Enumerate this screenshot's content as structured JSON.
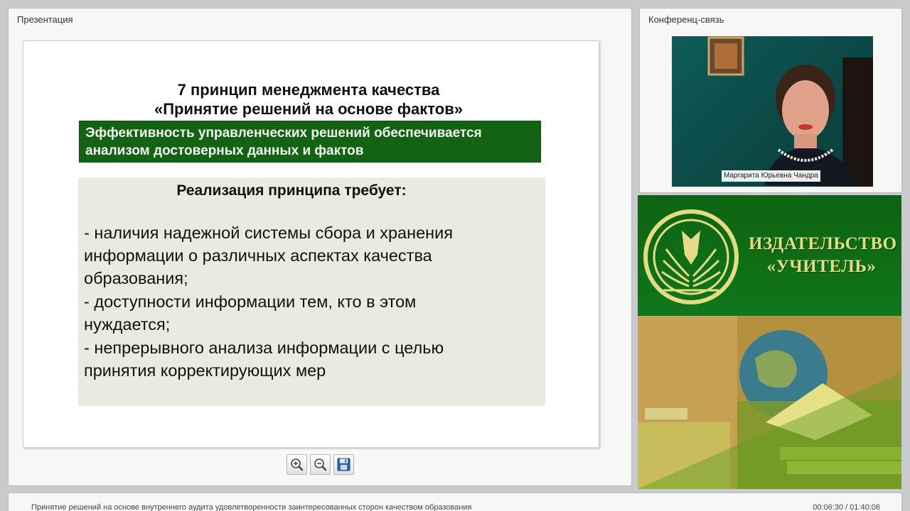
{
  "presentation": {
    "panel_title": "Презентация",
    "slide": {
      "title_line1": "7 принцип менеджмента качества",
      "title_line2": "«Принятие решений на основе фактов»",
      "highlight_line1": "Эффективность управленческих решений обеспечивается",
      "highlight_line2": "анализом достоверных данных и фактов",
      "requirements_heading": "Реализация принципа требует:",
      "bullet1_line1": "- наличия надежной системы сбора и хранения",
      "bullet1_line2": "информации о различных аспектах качества",
      "bullet1_line3": "образования;",
      "bullet2_line1": "- доступности информации тем, кто в этом",
      "bullet2_line2": "нуждается;",
      "bullet3_line1": "- непрерывного анализа информации с целью",
      "bullet3_line2": "принятия корректирующих мер"
    },
    "toolbar": {
      "zoom_in_icon": "zoom-in-icon",
      "zoom_out_icon": "zoom-out-icon",
      "save_icon": "floppy-disk-icon"
    }
  },
  "conference": {
    "panel_title": "Конференц-связь",
    "speaker_name": "Маргарита Юрьевна Чандра"
  },
  "promo": {
    "line1": "ИЗДАТЕЛЬСТВО",
    "line2": "«УЧИТЕЛЬ»"
  },
  "status_bar": {
    "title": "Принятие решений на основе внутреннего аудита удовлетворенности заинтересованных сторон качеством образования",
    "time": "00:06:30 / 01:40:06"
  },
  "colors": {
    "highlight_green": "#146314",
    "beige_box": "#ebeadf",
    "promo_green": "#0f6a12",
    "promo_gold": "#e3dc86"
  }
}
